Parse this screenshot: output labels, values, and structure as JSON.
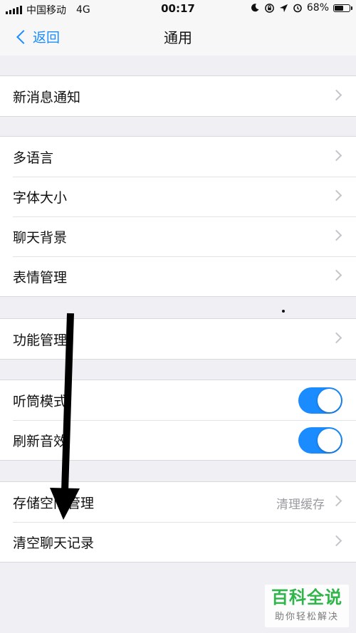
{
  "status_bar": {
    "carrier": "中国移动",
    "network": "4G",
    "time": "00:17",
    "battery_percent": "68%",
    "battery_level": 0.68,
    "icons": [
      "moon-icon",
      "orientation-lock-icon",
      "location-icon",
      "alarm-icon"
    ]
  },
  "nav": {
    "back_label": "返回",
    "title": "通用"
  },
  "groups": [
    {
      "rows": [
        {
          "label": "新消息通知",
          "type": "link"
        }
      ]
    },
    {
      "rows": [
        {
          "label": "多语言",
          "type": "link"
        },
        {
          "label": "字体大小",
          "type": "link"
        },
        {
          "label": "聊天背景",
          "type": "link"
        },
        {
          "label": "表情管理",
          "type": "link"
        }
      ]
    },
    {
      "rows": [
        {
          "label": "功能管理",
          "type": "link"
        }
      ]
    },
    {
      "rows": [
        {
          "label": "听筒模式",
          "type": "toggle",
          "on": true
        },
        {
          "label": "刷新音效",
          "type": "toggle",
          "on": true
        }
      ]
    },
    {
      "rows": [
        {
          "label": "存储空间管理",
          "type": "link",
          "value": "清理缓存"
        },
        {
          "label": "清空聊天记录",
          "type": "link"
        }
      ]
    }
  ],
  "watermark": {
    "title": "百科全说",
    "subtitle": "助你轻松解决"
  },
  "colors": {
    "accent": "#1a8cff",
    "background": "#efeff4",
    "watermark_green": "#2fb54a"
  }
}
